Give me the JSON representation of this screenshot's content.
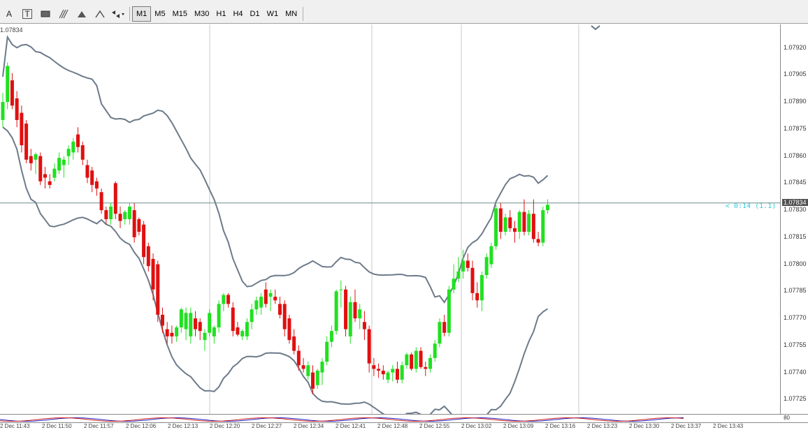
{
  "toolbar": {
    "tools": [
      {
        "name": "text-tool",
        "glyph": "A"
      },
      {
        "name": "text-label-tool",
        "glyph": "T"
      },
      {
        "name": "rectangle-tool",
        "glyph": ""
      },
      {
        "name": "fibonacci-tool",
        "glyph": ""
      },
      {
        "name": "triangle-up-arrow-tool",
        "glyph": ""
      },
      {
        "name": "triangle-down-arrow-tool",
        "glyph": ""
      },
      {
        "name": "objects-dropdown-tool",
        "glyph": ""
      }
    ],
    "timeframes": [
      "M1",
      "M5",
      "M15",
      "M30",
      "H1",
      "H4",
      "D1",
      "W1",
      "MN"
    ],
    "active_timeframe": "M1"
  },
  "chart": {
    "symbol_price_label": "1.07834",
    "current_price": "1.07834",
    "countdown": "< 0:14 (1.1)",
    "colors": {
      "bull": "#21e021",
      "bear": "#e01010",
      "band": "#6c7a8a",
      "grid": "#c8c8c8",
      "current": "#6c8c8c"
    },
    "price_labels": [
      "1.07920",
      "1.07905",
      "1.07890",
      "1.07875",
      "1.07860",
      "1.07845",
      "1.07830",
      "1.07815",
      "1.07800",
      "1.07785",
      "1.07770",
      "1.07755",
      "1.07740",
      "1.07725"
    ],
    "indicator_level": "80"
  },
  "time_axis": [
    "2 Dec 11:43",
    "2 Dec 11:50",
    "2 Dec 11:57",
    "2 Dec 12:06",
    "2 Dec 12:13",
    "2 Dec 12:20",
    "2 Dec 12:27",
    "2 Dec 12:34",
    "2 Dec 12:41",
    "2 Dec 12:48",
    "2 Dec 12:55",
    "2 Dec 13:02",
    "2 Dec 13:09",
    "2 Dec 13:16",
    "2 Dec 13:23",
    "2 Dec 13:30",
    "2 Dec 13:37",
    "2 Dec 13:43"
  ],
  "chart_data": {
    "type": "candlestick",
    "price_range": [
      1.07717,
      1.07933
    ],
    "candles": [
      [
        1.0788,
        1.07895,
        1.07876,
        1.0789
      ],
      [
        1.0789,
        1.07912,
        1.07886,
        1.0791
      ],
      [
        1.07902,
        1.07906,
        1.07886,
        1.07888
      ],
      [
        1.07892,
        1.07896,
        1.07876,
        1.0788
      ],
      [
        1.07884,
        1.07888,
        1.07862,
        1.07866
      ],
      [
        1.07878,
        1.0788,
        1.07856,
        1.07858
      ],
      [
        1.0786,
        1.07864,
        1.07852,
        1.07856
      ],
      [
        1.07858,
        1.07862,
        1.0785,
        1.07861
      ],
      [
        1.0786,
        1.07862,
        1.07844,
        1.07846
      ],
      [
        1.0785,
        1.07854,
        1.07842,
        1.07848
      ],
      [
        1.07846,
        1.0785,
        1.07842,
        1.07844
      ],
      [
        1.07848,
        1.07856,
        1.07846,
        1.07853
      ],
      [
        1.07852,
        1.07862,
        1.0785,
        1.07859
      ],
      [
        1.07855,
        1.0786,
        1.07848,
        1.07858
      ],
      [
        1.0786,
        1.07866,
        1.07855,
        1.07864
      ],
      [
        1.07862,
        1.0787,
        1.07858,
        1.07868
      ],
      [
        1.07872,
        1.07876,
        1.07862,
        1.07865
      ],
      [
        1.07866,
        1.07868,
        1.07855,
        1.07858
      ],
      [
        1.07855,
        1.07858,
        1.07845,
        1.07848
      ],
      [
        1.07852,
        1.07854,
        1.0784,
        1.07844
      ],
      [
        1.07846,
        1.07848,
        1.07838,
        1.07842
      ],
      [
        1.0784,
        1.07842,
        1.07828,
        1.0783
      ],
      [
        1.0783,
        1.07832,
        1.07822,
        1.07825
      ],
      [
        1.07825,
        1.07834,
        1.07822,
        1.07832
      ],
      [
        1.07845,
        1.07846,
        1.07825,
        1.07828
      ],
      [
        1.07828,
        1.07832,
        1.0782,
        1.07824
      ],
      [
        1.07825,
        1.0783,
        1.07822,
        1.07829
      ],
      [
        1.07825,
        1.07834,
        1.07822,
        1.07832
      ],
      [
        1.0783,
        1.07834,
        1.07812,
        1.07815
      ],
      [
        1.07825,
        1.07826,
        1.07816,
        1.07818
      ],
      [
        1.07822,
        1.07824,
        1.078,
        1.07804
      ],
      [
        1.0781,
        1.07812,
        1.07796,
        1.07799
      ],
      [
        1.07803,
        1.07806,
        1.0778,
        1.07786
      ],
      [
        1.078,
        1.07802,
        1.07768,
        1.07772
      ],
      [
        1.07772,
        1.07776,
        1.07762,
        1.07766
      ],
      [
        1.07764,
        1.07768,
        1.07756,
        1.0776
      ],
      [
        1.07762,
        1.07766,
        1.07756,
        1.0776
      ],
      [
        1.0776,
        1.07766,
        1.07757,
        1.07765
      ],
      [
        1.07765,
        1.07776,
        1.07762,
        1.07775
      ],
      [
        1.07764,
        1.07776,
        1.07758,
        1.07773
      ],
      [
        1.0776,
        1.07776,
        1.07756,
        1.07773
      ],
      [
        1.0777,
        1.07774,
        1.0776,
        1.07764
      ],
      [
        1.07768,
        1.0777,
        1.07758,
        1.07763
      ],
      [
        1.07758,
        1.07764,
        1.07752,
        1.07762
      ],
      [
        1.07762,
        1.07775,
        1.0776,
        1.07773
      ],
      [
        1.0776,
        1.07766,
        1.07756,
        1.07765
      ],
      [
        1.07765,
        1.0778,
        1.07762,
        1.07778
      ],
      [
        1.07778,
        1.07784,
        1.07774,
        1.07783
      ],
      [
        1.07783,
        1.07784,
        1.07776,
        1.07778
      ],
      [
        1.07776,
        1.07779,
        1.0776,
        1.07763
      ],
      [
        1.07765,
        1.07768,
        1.0776,
        1.07761
      ],
      [
        1.0776,
        1.07764,
        1.07758,
        1.07763
      ],
      [
        1.0776,
        1.0777,
        1.07758,
        1.07768
      ],
      [
        1.07768,
        1.07778,
        1.07764,
        1.07775
      ],
      [
        1.07775,
        1.07782,
        1.07772,
        1.0778
      ],
      [
        1.07776,
        1.07784,
        1.07772,
        1.07782
      ],
      [
        1.07786,
        1.0779,
        1.07776,
        1.07778
      ],
      [
        1.07782,
        1.07786,
        1.07774,
        1.07784
      ],
      [
        1.07782,
        1.07786,
        1.07778,
        1.0778
      ],
      [
        1.07778,
        1.07782,
        1.0777,
        1.07772
      ],
      [
        1.07778,
        1.0778,
        1.0776,
        1.07764
      ],
      [
        1.0777,
        1.07772,
        1.07756,
        1.07758
      ],
      [
        1.0776,
        1.07764,
        1.0775,
        1.07752
      ],
      [
        1.07752,
        1.07755,
        1.07741,
        1.07744
      ],
      [
        1.07744,
        1.07748,
        1.0774,
        1.07742
      ],
      [
        1.07738,
        1.07746,
        1.07736,
        1.07744
      ],
      [
        1.0774,
        1.07744,
        1.07728,
        1.07731
      ],
      [
        1.07733,
        1.07742,
        1.07731,
        1.07741
      ],
      [
        1.0774,
        1.07748,
        1.07733,
        1.07746
      ],
      [
        1.07746,
        1.0776,
        1.07744,
        1.07757
      ],
      [
        1.07757,
        1.07766,
        1.07754,
        1.07763
      ],
      [
        1.07763,
        1.07786,
        1.07761,
        1.07785
      ],
      [
        1.07786,
        1.07791,
        1.07776,
        1.07786
      ],
      [
        1.07786,
        1.07788,
        1.0776,
        1.07764
      ],
      [
        1.0776,
        1.07782,
        1.07756,
        1.07779
      ],
      [
        1.07779,
        1.07786,
        1.07768,
        1.0777
      ],
      [
        1.0777,
        1.07778,
        1.07764,
        1.07775
      ],
      [
        1.07768,
        1.07774,
        1.07758,
        1.07764
      ],
      [
        1.07764,
        1.07766,
        1.0774,
        1.07745
      ],
      [
        1.07744,
        1.07748,
        1.07738,
        1.07742
      ],
      [
        1.07742,
        1.07745,
        1.07737,
        1.07741
      ],
      [
        1.07741,
        1.07744,
        1.07736,
        1.07739
      ],
      [
        1.07736,
        1.07741,
        1.07734,
        1.0774
      ],
      [
        1.0774,
        1.07744,
        1.07735,
        1.07742
      ],
      [
        1.07742,
        1.07746,
        1.07734,
        1.07736
      ],
      [
        1.07736,
        1.07746,
        1.07734,
        1.07744
      ],
      [
        1.07744,
        1.07751,
        1.07742,
        1.0775
      ],
      [
        1.0775,
        1.07751,
        1.07741,
        1.07742
      ],
      [
        1.07742,
        1.07754,
        1.0774,
        1.07752
      ],
      [
        1.07752,
        1.07754,
        1.07742,
        1.07743
      ],
      [
        1.07743,
        1.07746,
        1.07738,
        1.07742
      ],
      [
        1.07742,
        1.0775,
        1.0774,
        1.07748
      ],
      [
        1.07748,
        1.07758,
        1.07746,
        1.07756
      ],
      [
        1.07756,
        1.0777,
        1.07754,
        1.07768
      ],
      [
        1.07768,
        1.07772,
        1.0776,
        1.07762
      ],
      [
        1.07762,
        1.07788,
        1.0776,
        1.07786
      ],
      [
        1.07786,
        1.078,
        1.07784,
        1.07792
      ],
      [
        1.07792,
        1.07804,
        1.0779,
        1.07796
      ],
      [
        1.07796,
        1.07808,
        1.07792,
        1.07802
      ],
      [
        1.07802,
        1.07806,
        1.07796,
        1.07798
      ],
      [
        1.07798,
        1.07802,
        1.0778,
        1.07784
      ],
      [
        1.07784,
        1.0779,
        1.07776,
        1.0778
      ],
      [
        1.0778,
        1.07796,
        1.07774,
        1.07794
      ],
      [
        1.07794,
        1.07806,
        1.07792,
        1.07804
      ],
      [
        1.078,
        1.07812,
        1.07798,
        1.0781
      ],
      [
        1.0781,
        1.07833,
        1.07808,
        1.07831
      ],
      [
        1.07831,
        1.07834,
        1.07814,
        1.07818
      ],
      [
        1.07818,
        1.07828,
        1.07816,
        1.07826
      ],
      [
        1.07826,
        1.0783,
        1.07818,
        1.0782
      ],
      [
        1.0782,
        1.07824,
        1.07812,
        1.07818
      ],
      [
        1.07818,
        1.0783,
        1.07814,
        1.07829
      ],
      [
        1.07829,
        1.07836,
        1.07816,
        1.07818
      ],
      [
        1.07818,
        1.0783,
        1.07816,
        1.07828
      ],
      [
        1.07828,
        1.07836,
        1.07812,
        1.07814
      ],
      [
        1.07814,
        1.07818,
        1.0781,
        1.07812
      ],
      [
        1.07812,
        1.07832,
        1.0781,
        1.0783
      ],
      [
        1.0783,
        1.07836,
        1.07828,
        1.07833
      ]
    ]
  }
}
